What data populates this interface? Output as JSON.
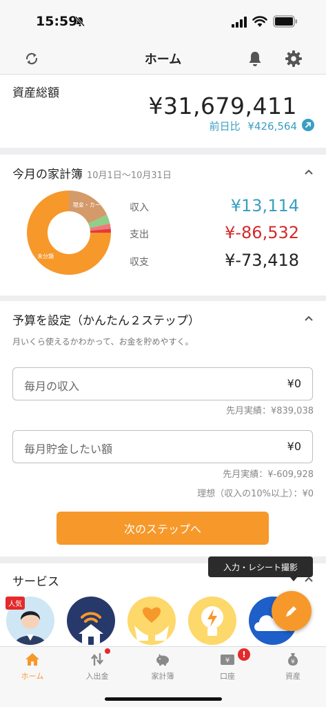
{
  "status": {
    "time": "15:59"
  },
  "nav": {
    "title": "ホーム"
  },
  "assets": {
    "title": "資産総額",
    "amount": "¥31,679,411",
    "diff_label": "前日比",
    "diff_value": "¥426,564"
  },
  "kakeibo": {
    "title": "今月の家計簿",
    "range": "10月1日〜10月31日",
    "rows": [
      {
        "label": "収入",
        "value": "¥13,114",
        "color": "#3a9ec2"
      },
      {
        "label": "支出",
        "value": "¥-86,532",
        "color": "#d42a2a"
      },
      {
        "label": "収支",
        "value": "¥-73,418",
        "color": "#222222"
      }
    ],
    "donut": {
      "segments": [
        {
          "label": "現金・カー",
          "share": 0.18,
          "color": "#d49a6a"
        },
        {
          "label": "",
          "share": 0.035,
          "color": "#8fcf8a"
        },
        {
          "label": "",
          "share": 0.02,
          "color": "#f07a7a"
        },
        {
          "label": "",
          "share": 0.015,
          "color": "#e23a3a"
        },
        {
          "label": "未分類",
          "share": 0.75,
          "color": "#f7982a"
        }
      ]
    }
  },
  "budget": {
    "title": "予算を設定（かんたん２ステップ）",
    "subtitle": "月いくら使えるかわかって、お金を貯めやすく。",
    "income_label": "毎月の収入",
    "income_value": "¥0",
    "income_hint": "先月実績：¥839,038",
    "saving_label": "毎月貯金したい額",
    "saving_value": "¥0",
    "saving_hint": "先月実績：¥-609,928",
    "ideal_hint": "理想（収入の10%以上）：¥0",
    "next_button": "次のステップへ"
  },
  "services": {
    "title": "サービス",
    "popular_badge": "人気"
  },
  "fab": {
    "tooltip": "入力・レシート撮影"
  },
  "tabs": [
    {
      "label": "ホーム"
    },
    {
      "label": "入出金"
    },
    {
      "label": "家計簿"
    },
    {
      "label": "口座"
    },
    {
      "label": "資産"
    }
  ],
  "colors": {
    "accent": "#f7982a",
    "positive": "#3a9ec2",
    "negative": "#d42a2a"
  }
}
